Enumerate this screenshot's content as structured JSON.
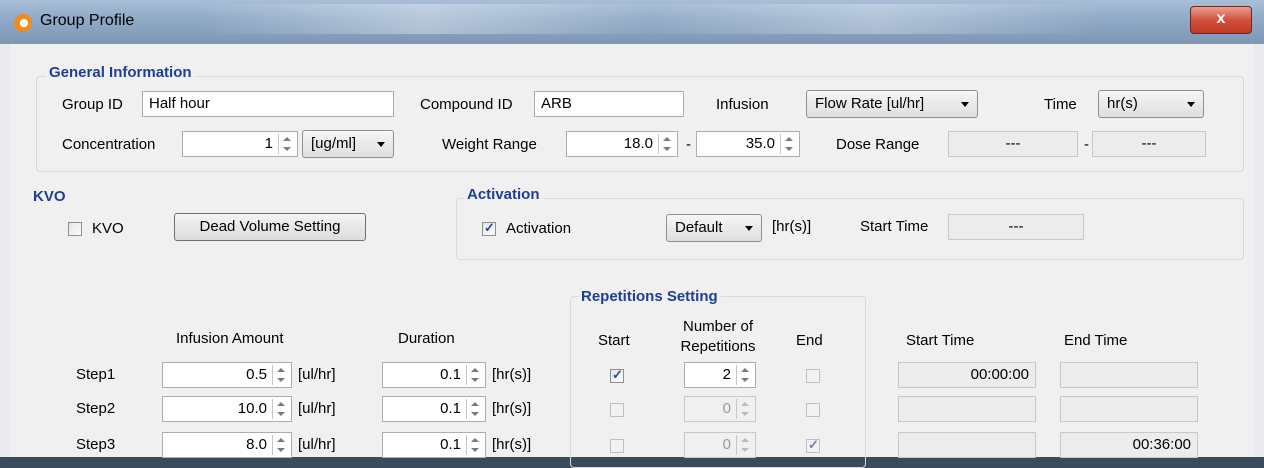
{
  "window": {
    "title": "Group Profile",
    "close_symbol": "x"
  },
  "general": {
    "legend": "General Information",
    "group_id_label": "Group ID",
    "group_id_value": "Half hour",
    "compound_id_label": "Compound ID",
    "compound_id_value": "ARB",
    "infusion_label": "Infusion",
    "infusion_value": "Flow Rate [ul/hr]",
    "time_label": "Time",
    "time_value": "hr(s)",
    "concentration_label": "Concentration",
    "concentration_value": "1",
    "concentration_unit": "[ug/ml]",
    "weight_range_label": "Weight Range",
    "weight_min": "18.0",
    "weight_max": "35.0",
    "dash": "-",
    "dose_range_label": "Dose Range",
    "dose_min": "---",
    "dose_max": "---"
  },
  "kvo": {
    "legend": "KVO",
    "checkbox_label": "KVO",
    "checked": false,
    "dead_volume_button": "Dead Volume Setting"
  },
  "activation": {
    "legend": "Activation",
    "checkbox_label": "Activation",
    "checked": true,
    "mode_value": "Default",
    "unit": "[hr(s)]",
    "start_time_label": "Start Time",
    "start_time_value": "---"
  },
  "steps": {
    "repetitions_legend": "Repetitions Setting",
    "headers": {
      "infusion_amount": "Infusion Amount",
      "duration": "Duration",
      "start": "Start",
      "number_of_repetitions_1": "Number of",
      "number_of_repetitions_2": "Repetitions",
      "end": "End",
      "start_time": "Start Time",
      "end_time": "End Time"
    },
    "amount_unit": "[ul/hr]",
    "duration_unit": "[hr(s)]",
    "rows": [
      {
        "label": "Step1",
        "amount": "0.5",
        "duration": "0.1",
        "start": true,
        "repetitions": "2",
        "end": false,
        "start_time": "00:00:00",
        "end_time": ""
      },
      {
        "label": "Step2",
        "amount": "10.0",
        "duration": "0.1",
        "start": false,
        "repetitions": "0",
        "end": false,
        "start_time": "",
        "end_time": ""
      },
      {
        "label": "Step3",
        "amount": "8.0",
        "duration": "0.1",
        "start": false,
        "repetitions": "0",
        "end": true,
        "start_time": "",
        "end_time": "00:36:00"
      }
    ]
  }
}
